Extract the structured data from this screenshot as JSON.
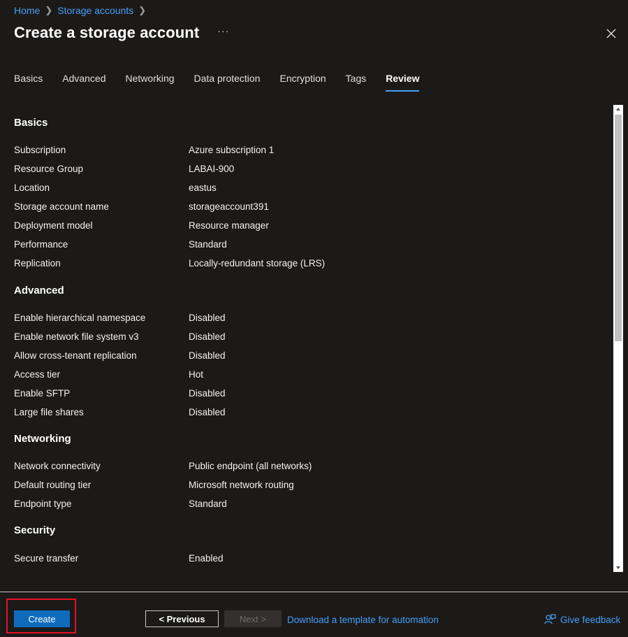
{
  "breadcrumb": [
    "Home",
    "Storage accounts"
  ],
  "page_title": "Create a storage account",
  "more_label": "···",
  "tabs": [
    "Basics",
    "Advanced",
    "Networking",
    "Data protection",
    "Encryption",
    "Tags",
    "Review"
  ],
  "active_tab": "Review",
  "sections": [
    {
      "title": "Basics",
      "rows": [
        {
          "k": "Subscription",
          "v": "Azure subscription 1"
        },
        {
          "k": "Resource Group",
          "v": "LABAI-900"
        },
        {
          "k": "Location",
          "v": "eastus"
        },
        {
          "k": "Storage account name",
          "v": "storageaccount391"
        },
        {
          "k": "Deployment model",
          "v": "Resource manager"
        },
        {
          "k": "Performance",
          "v": "Standard"
        },
        {
          "k": "Replication",
          "v": "Locally-redundant storage (LRS)"
        }
      ]
    },
    {
      "title": "Advanced",
      "rows": [
        {
          "k": "Enable hierarchical namespace",
          "v": "Disabled"
        },
        {
          "k": "Enable network file system v3",
          "v": "Disabled"
        },
        {
          "k": "Allow cross-tenant replication",
          "v": "Disabled"
        },
        {
          "k": "Access tier",
          "v": "Hot"
        },
        {
          "k": "Enable SFTP",
          "v": "Disabled"
        },
        {
          "k": "Large file shares",
          "v": "Disabled"
        }
      ]
    },
    {
      "title": "Networking",
      "rows": [
        {
          "k": "Network connectivity",
          "v": "Public endpoint (all networks)"
        },
        {
          "k": "Default routing tier",
          "v": "Microsoft network routing"
        },
        {
          "k": "Endpoint type",
          "v": "Standard"
        }
      ]
    },
    {
      "title": "Security",
      "rows": [
        {
          "k": "Secure transfer",
          "v": "Enabled"
        }
      ]
    }
  ],
  "footer": {
    "create_label": "Create",
    "previous_label": "< Previous",
    "next_label": "Next >",
    "download_label": "Download a template for automation",
    "feedback_label": "Give feedback"
  },
  "colors": {
    "accent": "#479ef5",
    "primary_button": "#0f6cbd",
    "highlight_border": "#e81123",
    "background": "#1b1a19"
  }
}
